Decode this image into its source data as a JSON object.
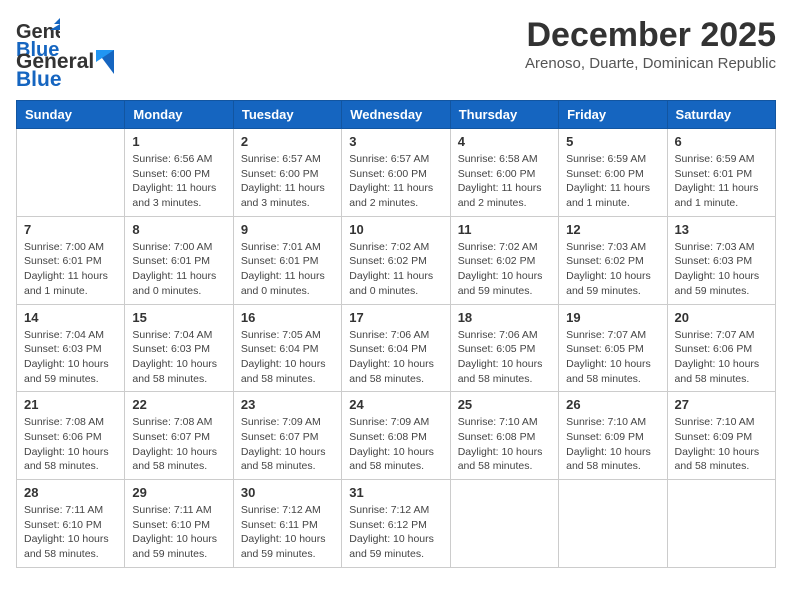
{
  "header": {
    "logo_general": "General",
    "logo_blue": "Blue",
    "month": "December 2025",
    "location": "Arenoso, Duarte, Dominican Republic"
  },
  "days_of_week": [
    "Sunday",
    "Monday",
    "Tuesday",
    "Wednesday",
    "Thursday",
    "Friday",
    "Saturday"
  ],
  "weeks": [
    [
      {
        "day": "",
        "info": ""
      },
      {
        "day": "1",
        "info": "Sunrise: 6:56 AM\nSunset: 6:00 PM\nDaylight: 11 hours\nand 3 minutes."
      },
      {
        "day": "2",
        "info": "Sunrise: 6:57 AM\nSunset: 6:00 PM\nDaylight: 11 hours\nand 3 minutes."
      },
      {
        "day": "3",
        "info": "Sunrise: 6:57 AM\nSunset: 6:00 PM\nDaylight: 11 hours\nand 2 minutes."
      },
      {
        "day": "4",
        "info": "Sunrise: 6:58 AM\nSunset: 6:00 PM\nDaylight: 11 hours\nand 2 minutes."
      },
      {
        "day": "5",
        "info": "Sunrise: 6:59 AM\nSunset: 6:00 PM\nDaylight: 11 hours\nand 1 minute."
      },
      {
        "day": "6",
        "info": "Sunrise: 6:59 AM\nSunset: 6:01 PM\nDaylight: 11 hours\nand 1 minute."
      }
    ],
    [
      {
        "day": "7",
        "info": "Sunrise: 7:00 AM\nSunset: 6:01 PM\nDaylight: 11 hours\nand 1 minute."
      },
      {
        "day": "8",
        "info": "Sunrise: 7:00 AM\nSunset: 6:01 PM\nDaylight: 11 hours\nand 0 minutes."
      },
      {
        "day": "9",
        "info": "Sunrise: 7:01 AM\nSunset: 6:01 PM\nDaylight: 11 hours\nand 0 minutes."
      },
      {
        "day": "10",
        "info": "Sunrise: 7:02 AM\nSunset: 6:02 PM\nDaylight: 11 hours\nand 0 minutes."
      },
      {
        "day": "11",
        "info": "Sunrise: 7:02 AM\nSunset: 6:02 PM\nDaylight: 10 hours\nand 59 minutes."
      },
      {
        "day": "12",
        "info": "Sunrise: 7:03 AM\nSunset: 6:02 PM\nDaylight: 10 hours\nand 59 minutes."
      },
      {
        "day": "13",
        "info": "Sunrise: 7:03 AM\nSunset: 6:03 PM\nDaylight: 10 hours\nand 59 minutes."
      }
    ],
    [
      {
        "day": "14",
        "info": "Sunrise: 7:04 AM\nSunset: 6:03 PM\nDaylight: 10 hours\nand 59 minutes."
      },
      {
        "day": "15",
        "info": "Sunrise: 7:04 AM\nSunset: 6:03 PM\nDaylight: 10 hours\nand 58 minutes."
      },
      {
        "day": "16",
        "info": "Sunrise: 7:05 AM\nSunset: 6:04 PM\nDaylight: 10 hours\nand 58 minutes."
      },
      {
        "day": "17",
        "info": "Sunrise: 7:06 AM\nSunset: 6:04 PM\nDaylight: 10 hours\nand 58 minutes."
      },
      {
        "day": "18",
        "info": "Sunrise: 7:06 AM\nSunset: 6:05 PM\nDaylight: 10 hours\nand 58 minutes."
      },
      {
        "day": "19",
        "info": "Sunrise: 7:07 AM\nSunset: 6:05 PM\nDaylight: 10 hours\nand 58 minutes."
      },
      {
        "day": "20",
        "info": "Sunrise: 7:07 AM\nSunset: 6:06 PM\nDaylight: 10 hours\nand 58 minutes."
      }
    ],
    [
      {
        "day": "21",
        "info": "Sunrise: 7:08 AM\nSunset: 6:06 PM\nDaylight: 10 hours\nand 58 minutes."
      },
      {
        "day": "22",
        "info": "Sunrise: 7:08 AM\nSunset: 6:07 PM\nDaylight: 10 hours\nand 58 minutes."
      },
      {
        "day": "23",
        "info": "Sunrise: 7:09 AM\nSunset: 6:07 PM\nDaylight: 10 hours\nand 58 minutes."
      },
      {
        "day": "24",
        "info": "Sunrise: 7:09 AM\nSunset: 6:08 PM\nDaylight: 10 hours\nand 58 minutes."
      },
      {
        "day": "25",
        "info": "Sunrise: 7:10 AM\nSunset: 6:08 PM\nDaylight: 10 hours\nand 58 minutes."
      },
      {
        "day": "26",
        "info": "Sunrise: 7:10 AM\nSunset: 6:09 PM\nDaylight: 10 hours\nand 58 minutes."
      },
      {
        "day": "27",
        "info": "Sunrise: 7:10 AM\nSunset: 6:09 PM\nDaylight: 10 hours\nand 58 minutes."
      }
    ],
    [
      {
        "day": "28",
        "info": "Sunrise: 7:11 AM\nSunset: 6:10 PM\nDaylight: 10 hours\nand 58 minutes."
      },
      {
        "day": "29",
        "info": "Sunrise: 7:11 AM\nSunset: 6:10 PM\nDaylight: 10 hours\nand 59 minutes."
      },
      {
        "day": "30",
        "info": "Sunrise: 7:12 AM\nSunset: 6:11 PM\nDaylight: 10 hours\nand 59 minutes."
      },
      {
        "day": "31",
        "info": "Sunrise: 7:12 AM\nSunset: 6:12 PM\nDaylight: 10 hours\nand 59 minutes."
      },
      {
        "day": "",
        "info": ""
      },
      {
        "day": "",
        "info": ""
      },
      {
        "day": "",
        "info": ""
      }
    ]
  ]
}
